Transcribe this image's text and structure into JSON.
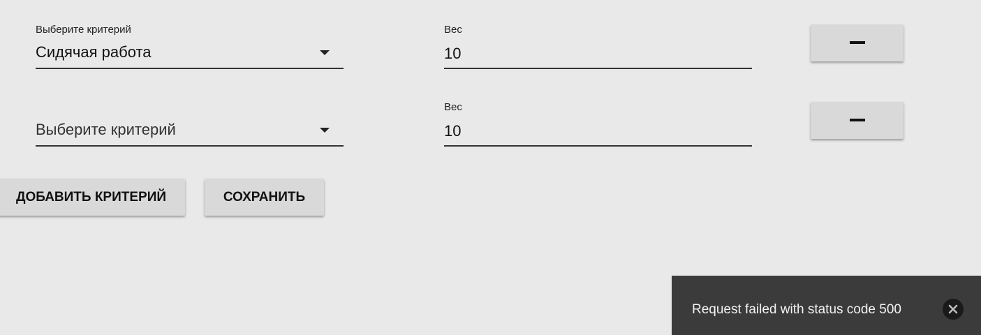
{
  "criteria_rows": [
    {
      "select_label": "Выберите критерий",
      "select_value": "Сидячая работа",
      "weight_label": "Вес",
      "weight_value": "10"
    },
    {
      "select_label": "",
      "select_value": "Выберите критерий",
      "weight_label": "Вес",
      "weight_value": "10"
    }
  ],
  "actions": {
    "add_label": "ДОБАВИТЬ КРИТЕРИЙ",
    "save_label": "СОХРАНИТЬ"
  },
  "toast": {
    "message": "Request failed with status code 500"
  },
  "icons": {
    "remove": "minus-icon",
    "dropdown": "dropdown-arrow-icon",
    "close": "close-circle-icon"
  },
  "colors": {
    "background": "#e9e9e9",
    "button": "#d9d9d9",
    "toast_background": "#3b3b3b"
  }
}
